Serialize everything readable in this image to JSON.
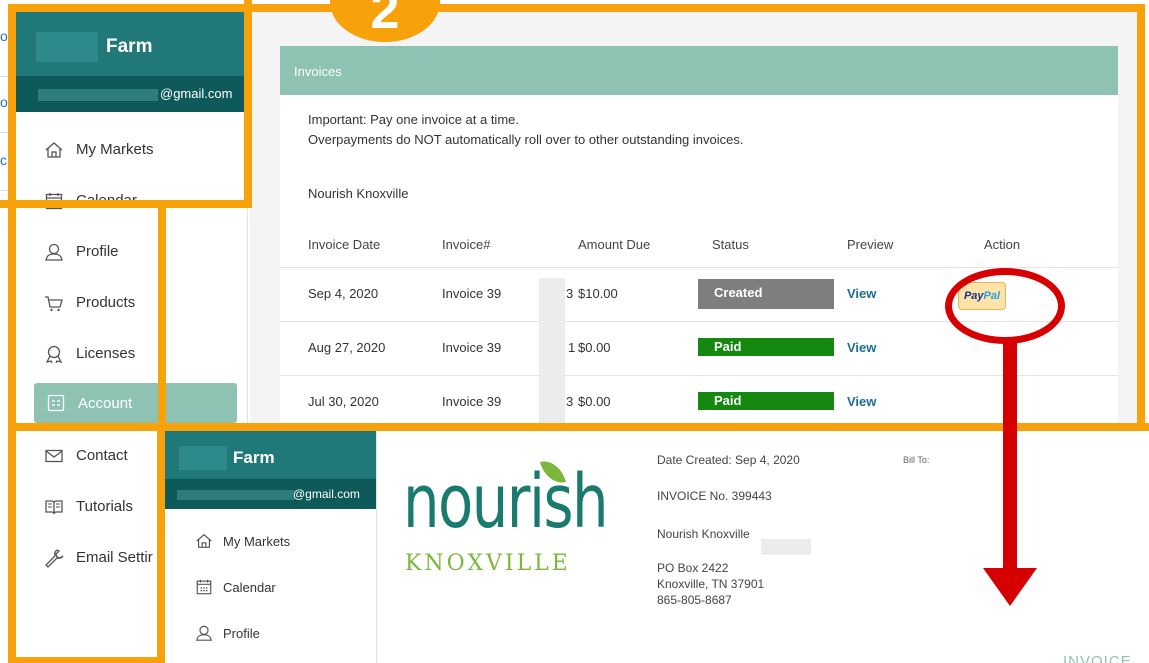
{
  "background": {
    "fragments": [
      "oc",
      "o",
      "c"
    ]
  },
  "annotation": {
    "step_number": "2",
    "frame_color": "#f7a20a",
    "pointer_color": "#d60000"
  },
  "sidebar": {
    "farm_name": "Farm",
    "email_domain": "@gmail.com",
    "items": [
      {
        "label": "My Markets",
        "icon": "home-icon"
      },
      {
        "label": "Calendar",
        "icon": "calendar-icon"
      },
      {
        "label": "Profile",
        "icon": "person-icon"
      },
      {
        "label": "Products",
        "icon": "cart-icon"
      },
      {
        "label": "Licenses",
        "icon": "ribbon-icon"
      },
      {
        "label": "Account",
        "icon": "account-icon",
        "active": true
      },
      {
        "label": "Contact",
        "icon": "envelope-icon"
      },
      {
        "label": "Tutorials",
        "icon": "book-icon"
      },
      {
        "label": "Email Settir",
        "icon": "wrench-icon"
      }
    ]
  },
  "invoices": {
    "title": "Invoices",
    "notice_line1": "Important: Pay one invoice at a time.",
    "notice_line2": "Overpayments do NOT automatically roll over to other outstanding invoices.",
    "market": "Nourish Knoxville",
    "columns": [
      "Invoice Date",
      "Invoice#",
      "Amount Due",
      "Status",
      "Preview",
      "Action"
    ],
    "rows": [
      {
        "date": "Sep 4, 2020",
        "invoice": "Invoice 39",
        "invoice_tail": "3",
        "amount": "$10.00",
        "status": "Created",
        "preview": "View",
        "action": "PayPal"
      },
      {
        "date": "Aug 27, 2020",
        "invoice": "Invoice 39",
        "invoice_tail": "1",
        "amount": "$0.00",
        "status": "Paid",
        "preview": "View",
        "action": ""
      },
      {
        "date": "Jul 30, 2020",
        "invoice": "Invoice 39",
        "invoice_tail": "3",
        "amount": "$0.00",
        "status": "Paid",
        "preview": "View",
        "action": ""
      }
    ],
    "paypal_part1": "Pay",
    "paypal_part2": "Pal"
  },
  "inset": {
    "farm_name": "Farm",
    "email_domain": "@gmail.com",
    "items": [
      {
        "label": "My Markets",
        "icon": "home-icon"
      },
      {
        "label": "Calendar",
        "icon": "calendar-icon"
      },
      {
        "label": "Profile",
        "icon": "person-icon"
      }
    ],
    "logo_word": "nourish",
    "logo_city": "KNOXVILLE",
    "date_created": "Date Created: Sep 4, 2020",
    "invoice_no": "INVOICE No. 399443",
    "market": "Nourish Knoxville",
    "address1": "PO Box 2422",
    "address2": "Knoxville, TN 37901",
    "phone": "865-805-8687",
    "bill_to": "Bill To:",
    "invoice_title": "INVOICE"
  }
}
